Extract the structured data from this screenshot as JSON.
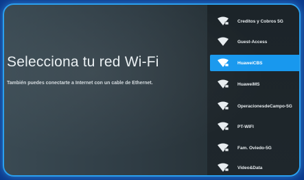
{
  "page": {
    "title": "Selecciona tu red Wi-Fi",
    "subtitle": "También puedes conectarte a Internet con un cable de Ethernet."
  },
  "networks": [
    {
      "name": "Creditos y Cobros 5G",
      "locked": true,
      "selected": false
    },
    {
      "name": "Guest-Access",
      "locked": false,
      "selected": false
    },
    {
      "name": "HuaweiCBS",
      "locked": true,
      "selected": true
    },
    {
      "name": "HuaweiMS",
      "locked": true,
      "selected": false
    },
    {
      "name": "OperacionesdeCampo-5G",
      "locked": true,
      "selected": false
    },
    {
      "name": "PT-WIFI",
      "locked": true,
      "selected": false
    },
    {
      "name": "Fam. Oviedo-5G",
      "locked": true,
      "selected": false
    },
    {
      "name": "Video&Data",
      "locked": true,
      "selected": false
    }
  ],
  "colors": {
    "accent": "#1898ee",
    "border_glow": "#2aa0f0"
  },
  "icons": {
    "wifi": "wifi-icon",
    "lock": "lock-icon"
  }
}
